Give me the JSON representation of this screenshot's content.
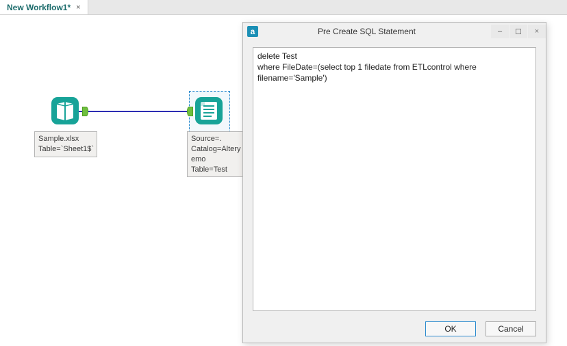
{
  "tab": {
    "title": "New Workflow1*",
    "close_glyph": "×"
  },
  "canvas": {
    "input_node": {
      "label": "Sample.xlsx\nTable=`Sheet1$`"
    },
    "output_node": {
      "label": "Source=.\nCatalog=Altery\nemo\nTable=Test"
    }
  },
  "dialog": {
    "app_icon_glyph": "a",
    "title": "Pre Create SQL Statement",
    "minimize_glyph": "–",
    "maximize_glyph": "☐",
    "close_glyph": "×",
    "sql_text": "delete Test\nwhere FileDate=(select top 1 filedate from ETLcontrol where filename='Sample')",
    "ok_label": "OK",
    "cancel_label": "Cancel"
  }
}
